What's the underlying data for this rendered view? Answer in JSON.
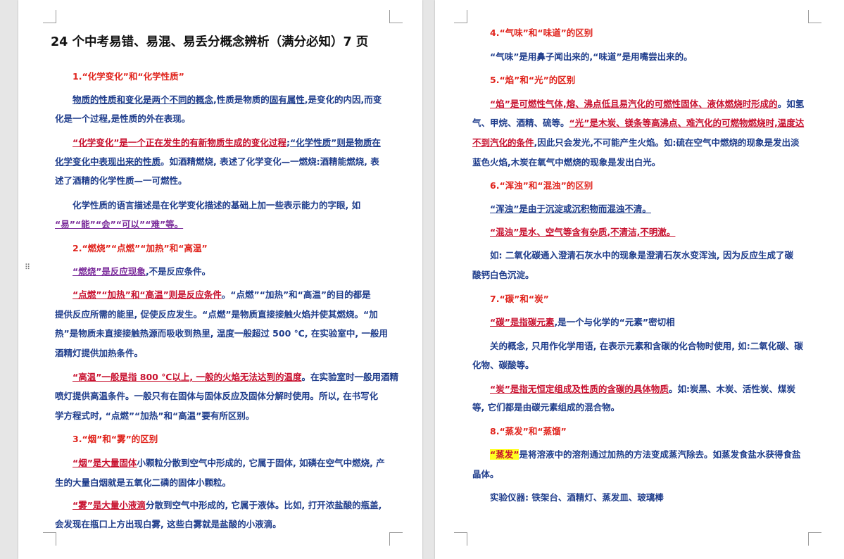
{
  "left_page": {
    "title": "24 个中考易错、易混、易丢分概念辨析（满分必知）7 页",
    "s1_heading": "1.“化学变化”和“化学性质”",
    "s1_p1_a": "物质的性质和变化是两个不同的概念",
    "s1_p1_b": ",性质是物质的",
    "s1_p1_c": "固有属性",
    "s1_p1_d": ",是变化的内因,而变",
    "s1_p1_e": "化是一个过程,是性质的外在表现。",
    "s1_p2_a": "“化学变化”是一个正在发生的有新物质生成的变化过程",
    "s1_p2_b": ";",
    "s1_p2_c": "“化学性质”则是物质在",
    "s1_p2_d": "化学变化中表现出来的性质",
    "s1_p2_e": "。如酒精燃烧, 表述了化学变化—一燃烧:酒精能燃烧, 表",
    "s1_p2_f": "述了酒精的化学性质—一可燃性。",
    "s1_p3_a": "化学性质的语言描述是在化学变化描述的基础上加一些表示能力的字眼, 如",
    "s1_p3_b": "“易”“能”“会”“可以”“难”等。",
    "s2_heading": "2.“燃烧”“点燃”“加热”和“高温”",
    "s2_p1_a": "“燃烧”是反应现象",
    "s2_p1_b": ",不是反应条件。",
    "s2_p2_a": "“点燃”“加热”和“高温”则是反应条件",
    "s2_p2_b": "。“点燃”“加热”和“高温”的目的都是",
    "s2_p2_c": "提供反应所需的能里, 促使反应发生。“点燃”是物质直接接触火焰并使其燃烧。“加",
    "s2_p2_d": "热”是物质未直接接触热源而吸收到热里, 温度一般超过 500 ℃, 在实验室中, 一般用",
    "s2_p2_e": "酒精灯提供加热条件。",
    "s2_p3_a": "“高温”一般是指 800 ℃以上, 一般的火焰无法达到的温度",
    "s2_p3_b": "。在实验室时一般用酒精",
    "s2_p3_c": "喷灯提供高温条件。一般只有在固体与固体反应及固体分解时使用。所以, 在书写化",
    "s2_p3_d": "学方程式时, “点燃”“加热”和“高温”要有所区别。",
    "s3_heading": "3.“烟”和“雾”的区别",
    "s3_p1_a": "“烟”是大量固体",
    "s3_p1_b": "小颗粒分散到空气中形成的, 它属于固体, 如磷在空气中燃烧, 产",
    "s3_p1_c": "生的大量白烟就是五氧化二磷的固体小颗粒。",
    "s3_p2_a": "“雾”是大量小液滴",
    "s3_p2_b": "分散到空气中形成的, 它属于液体。比如, 打开浓盐酸的瓶盖,",
    "s3_p2_c": "会发现在瓶口上方出现白雾, 这些白雾就是盐酸的小液滴。"
  },
  "right_page": {
    "s4_heading": "4.“气味”和“味道”的区别",
    "s4_p1": "“气味”是用鼻子闻出来的,“味道”是用嘴尝出来的。",
    "s5_heading": "5.“焰”和“光”的区别",
    "s5_p1_a": "“焰”是可燃性气体,熔、沸点低且易汽化的可燃性固体、液体燃烧时形成的",
    "s5_p1_b": "。如氢",
    "s5_p1_c": "气、甲烷、酒精、硫等。",
    "s5_p1_d": "“光”是木炭、镁条等高沸点、难汽化的可燃物燃烧时,温度达",
    "s5_p1_e": "不到汽化的条件",
    "s5_p1_f": ",因此只会发光,不可能产生火焰。如:硫在空气中燃烧的现象是发出淡",
    "s5_p1_g": "蓝色火焰,木炭在氧气中燃烧的现象是发出白光。",
    "s6_heading": "6.“浑浊”和“混浊”的区别",
    "s6_p1": "“浑浊”是由于沉淀或沉积物而混浊不清。",
    "s6_p2": "“混浊”是水、空气等含有杂质,不清洁,不明澈。",
    "s6_p3_a": "如: 二氧化碳通入澄清石灰水中的现象是澄清石灰水变浑浊, 因为反应生成了碳",
    "s6_p3_b": "酸钙白色沉淀。",
    "s7_heading": "7.“碳”和“炭”",
    "s7_p1_a": "“碳”是指碳元素",
    "s7_p1_b": ",是一个与化学的“元素”密切相",
    "s7_p2_a": "关的概念, 只用作化学用语, 在表示元素和含碳的化合物时使用, 如:二氧化碳、碳",
    "s7_p2_b": "化物、碳酸等。",
    "s7_p3_a": "“炭”是指无恒定组成及性质的含碳的具体物质",
    "s7_p3_b": "。如:炭黑、木炭、活性炭、煤炭",
    "s7_p3_c": "等, 它们都是由碳元素组成的混合物。",
    "s8_heading": "8.“蒸发”和“蒸馏”",
    "s8_p1_a": "“蒸发”",
    "s8_p1_b": "是将溶液中的溶剂通过加热的方法变成蒸汽除去。如蒸发食盐水获得食盐",
    "s8_p1_c": "晶体。",
    "s8_p2": "实验仪器: 铁架台、酒精灯、蒸发皿、玻璃棒"
  },
  "colors": {
    "body_text": "#1f3d8c",
    "heading_red": "#e0231c",
    "emphasis_red": "#c8102e",
    "purple": "#7a2a9a",
    "highlight": "#ffff22",
    "page_background": "#e6e6e6"
  }
}
